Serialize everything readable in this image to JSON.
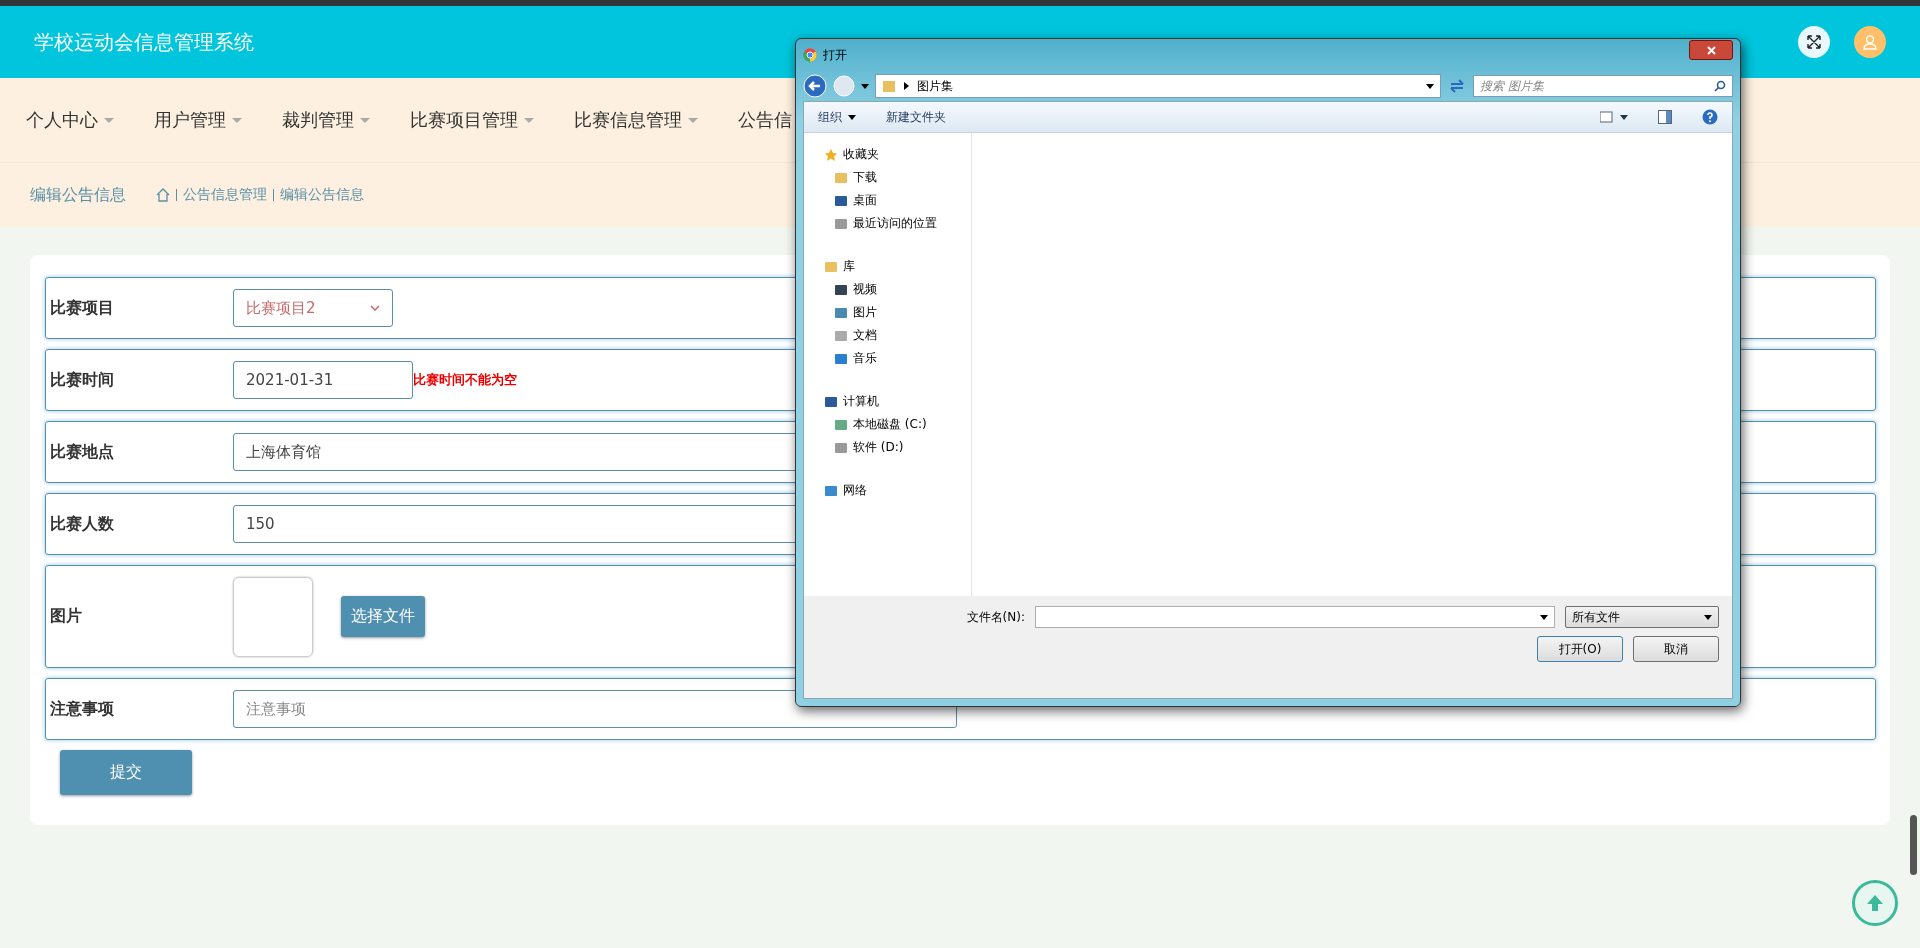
{
  "header": {
    "title": "学校运动会信息管理系统"
  },
  "nav": [
    {
      "label": "个人中心"
    },
    {
      "label": "用户管理"
    },
    {
      "label": "裁判管理"
    },
    {
      "label": "比赛项目管理"
    },
    {
      "label": "比赛信息管理"
    },
    {
      "label": "公告信"
    }
  ],
  "breadcrumb": {
    "title": "编辑公告信息",
    "path": [
      "公告信息管理",
      "编辑公告信息"
    ]
  },
  "form": {
    "fields": [
      {
        "kind": "select",
        "label": "比赛项目",
        "value": "比赛项目2"
      },
      {
        "kind": "input",
        "label": "比赛时间",
        "value": "2021-01-31",
        "error": "比赛时间不能为空"
      },
      {
        "kind": "input",
        "label": "比赛地点",
        "value": "上海体育馆"
      },
      {
        "kind": "input",
        "label": "比赛人数",
        "value": "150"
      },
      {
        "kind": "image",
        "label": "图片",
        "button": "选择文件"
      },
      {
        "kind": "input",
        "label": "注意事项",
        "placeholder": "注意事项"
      }
    ],
    "submit": "提交"
  },
  "dialog": {
    "title": "打开",
    "address": "图片集",
    "search_placeholder": "搜索 图片集",
    "toolbar": [
      "组织",
      "新建文件夹"
    ],
    "sidebar": [
      {
        "label": "收藏夹",
        "children": [
          {
            "label": "下载"
          },
          {
            "label": "桌面"
          },
          {
            "label": "最近访问的位置"
          }
        ]
      },
      {
        "label": "库",
        "children": [
          {
            "label": "视频"
          },
          {
            "label": "图片"
          },
          {
            "label": "文档"
          },
          {
            "label": "音乐"
          }
        ]
      },
      {
        "label": "计算机",
        "children": [
          {
            "label": "本地磁盘 (C:)"
          },
          {
            "label": "软件 (D:)"
          }
        ]
      },
      {
        "label": "网络"
      }
    ],
    "filename_label": "文件名(N):",
    "filetype": "所有文件",
    "buttons": [
      {
        "label": "打开(O)",
        "kind": "primary"
      },
      {
        "label": "取消",
        "kind": "secondary"
      }
    ]
  }
}
